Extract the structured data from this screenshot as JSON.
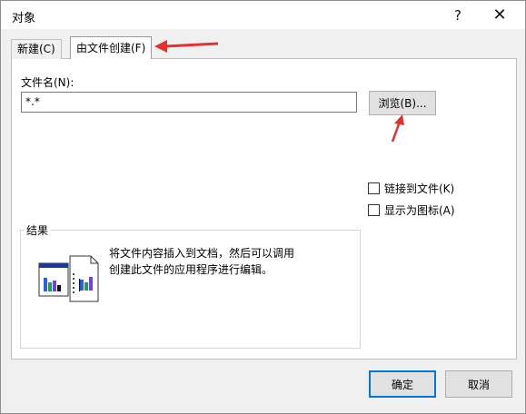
{
  "dialog": {
    "title": "对象",
    "help_label": "?",
    "close_label": "✕"
  },
  "tabs": [
    {
      "label": "新建(C)"
    },
    {
      "label": "由文件创建(F)"
    }
  ],
  "filename": {
    "label": "文件名(N):",
    "value": "*.*"
  },
  "browse_label": "浏览(B)...",
  "options": {
    "link_label": "链接到文件(K)",
    "icon_label": "显示为图标(A)"
  },
  "result": {
    "legend": "结果",
    "text": "将文件内容插入到文档，然后可以调用创建此文件的应用程序进行编辑。"
  },
  "buttons": {
    "ok": "确定",
    "cancel": "取消"
  },
  "annotation_color": "#e53030"
}
